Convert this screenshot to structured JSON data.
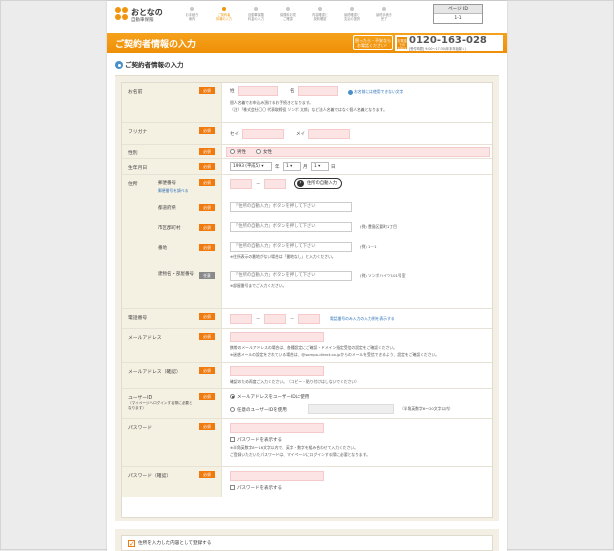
{
  "logo": {
    "line1": "おとなの",
    "line2": "自動車保険"
  },
  "steps": [
    {
      "label": "お手続き\n案内",
      "active": false
    },
    {
      "label": "ご契約者\n情報の入力",
      "active": true
    },
    {
      "label": "自動車保険\n料金の入力",
      "active": false
    },
    {
      "label": "保険料お見\nご確認",
      "active": false
    },
    {
      "label": "内容確認と\n契約確認",
      "active": false
    },
    {
      "label": "最終確認と\n支払の選択",
      "active": false
    },
    {
      "label": "最終手続き\n完了",
      "active": false
    }
  ],
  "page_box": {
    "label": "ページ ID",
    "value": "1-1"
  },
  "banner": {
    "title": "ご契約者情報の入力",
    "help": "困ったら・不安なら\nお電話ください！",
    "phone_badge": "お電話\nでの\nお申込",
    "phone": "0120-163-028",
    "hours": "[受付時間] 9:00～17:30(年末年始除く)"
  },
  "section_title": "ご契約者情報の入力",
  "required": "必須",
  "optional": "任意",
  "name": {
    "label": "お名前",
    "sei": "姓",
    "mei": "名",
    "link": "お名前には使用できない文字",
    "note1": "個人名義でお申込み頂けるお手続きとなります。",
    "note2": "（注）「株式会社〇〇 代表取締役 ソンポ 太郎」など法人名義ではなく個人名義となります。"
  },
  "furigana": {
    "label": "フリガナ",
    "sei": "セイ",
    "mei": "メイ"
  },
  "gender": {
    "label": "性別",
    "male": "男性",
    "female": "女性"
  },
  "birth": {
    "label": "生年月日",
    "year": "1993 (平成5)",
    "year_unit": "年",
    "month": "1",
    "month_unit": "月",
    "day": "1",
    "day_unit": "日"
  },
  "address": {
    "label": "住所",
    "postal": "郵便番号",
    "postal_link": "郵便番号を調べる",
    "auto_btn": "住所の自動入力",
    "prefecture": "都道府県",
    "city": "市区郡町村",
    "street": "番地",
    "building": "建物名・部屋番号",
    "placeholder": "「住所の自動入力」ボタンを押して下さい",
    "city_example": "(例) 豊島区要町1丁目",
    "street_example": "(例) 1－1",
    "street_note": "※住所表示の番地がない場合は「番地なし」と入力ください。",
    "building_example": "(例) ソンポハイツ101号室",
    "building_note": "※部屋番号までご入力ください。"
  },
  "phone": {
    "label": "電話番号",
    "link": "電話番号のみ入力の入力例を表示する"
  },
  "email": {
    "label": "メールアドレス",
    "note1": "携帯のメールアドレスの場合は、各種設定にご確認・ドメイン指定受信の設定をご確認ください。",
    "note2": "※迷惑メールの設定をされている場合は、@sompo-direct.co.jpからのメールを受信できるよう、設定をご確認ください。"
  },
  "email_confirm": {
    "label": "メールアドレス（確認）",
    "note": "確認のため再度ご入力ください。（コピー・貼り付けはしないでください）"
  },
  "user_id": {
    "label": "ユーザーID",
    "sub": "（マイページへログインする際に必要となります）",
    "opt1": "メールアドレスをユーザーIDに使用",
    "opt2": "任意のユーザーIDを使用",
    "rule": "（半角英数字6～20文字以内）"
  },
  "password": {
    "label": "パスワード",
    "show": "パスワードを表示する",
    "note1": "※半角英数字8～16文字以内で、英字・数字を組み合わせて入力ください。",
    "note2": "ご登録いただいたパスワードは、マイページにログインする際に必要となります。"
  },
  "password_confirm": {
    "label": "パスワード（確認）",
    "show": "パスワードを表示する"
  },
  "bottom": {
    "text": "住所を入力した内容として登録する"
  }
}
